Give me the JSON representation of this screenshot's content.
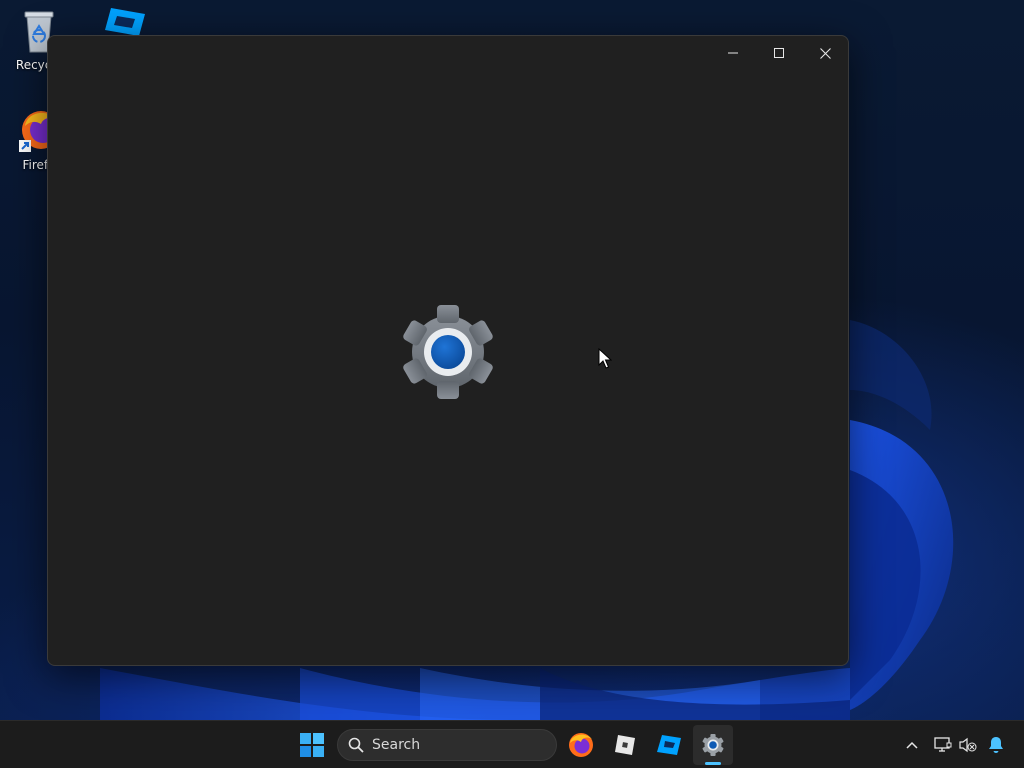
{
  "desktop": {
    "icons": [
      {
        "label": "Recycle",
        "icon": "recycle-bin-icon"
      },
      {
        "label": "Firefo",
        "icon": "firefox-icon"
      },
      {
        "label": "",
        "icon": "roblox-studio-icon"
      }
    ]
  },
  "window": {
    "title": "",
    "splash_icon": "settings-gear-icon",
    "controls": {
      "minimize": "minimize-icon",
      "maximize": "maximize-icon",
      "close": "close-icon"
    }
  },
  "taskbar": {
    "search": {
      "label": "Search",
      "icon": "search-icon"
    },
    "apps": [
      {
        "name": "start",
        "icon": "windows-logo-icon"
      },
      {
        "name": "firefox",
        "icon": "firefox-icon"
      },
      {
        "name": "roblox-player",
        "icon": "roblox-icon"
      },
      {
        "name": "roblox-studio",
        "icon": "roblox-studio-icon"
      },
      {
        "name": "settings",
        "icon": "settings-gear-icon",
        "active": true
      }
    ],
    "tray": [
      "chevron-up-icon",
      "network-icon",
      "volume-muted-icon",
      "bell-icon"
    ]
  },
  "colors": {
    "window_bg": "#202020",
    "taskbar_bg": "#1c1c1c",
    "accent": "#4cc2ff",
    "gear_grey": "#7a7f86",
    "gear_blue": "#0f5bb5"
  }
}
